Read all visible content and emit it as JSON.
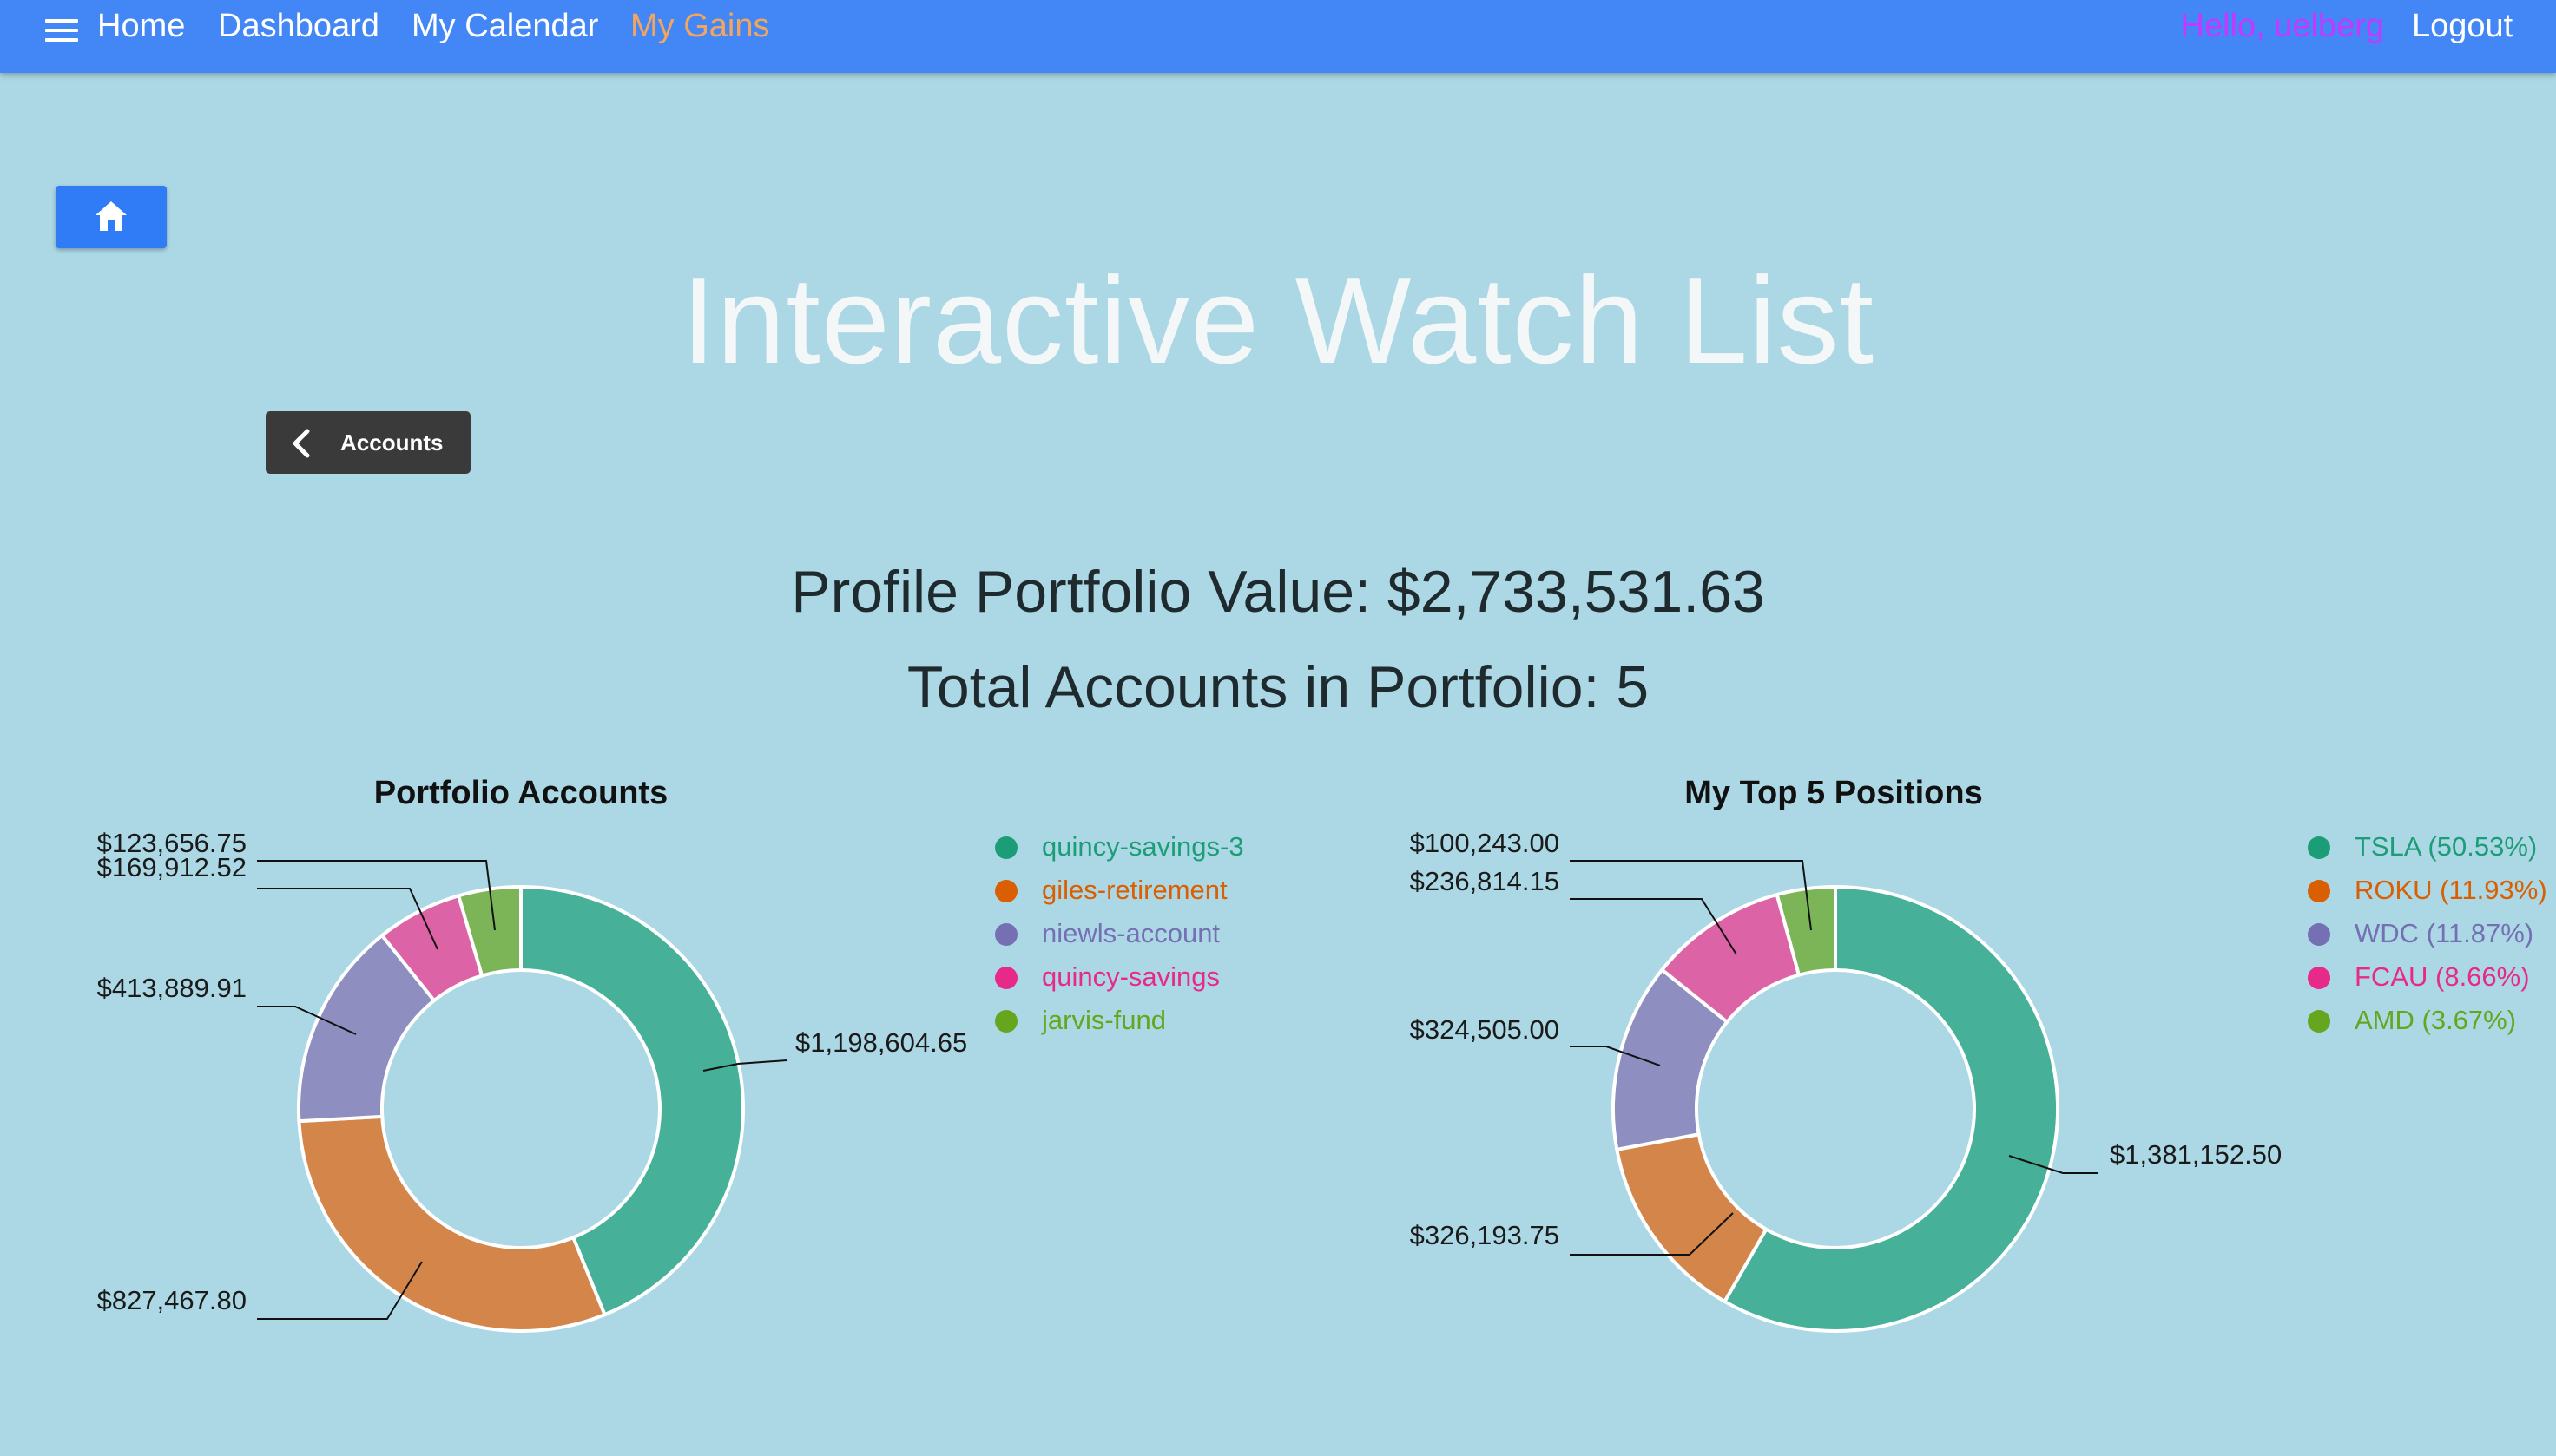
{
  "nav": {
    "menu_icon": "menu-icon",
    "items": [
      "Home",
      "Dashboard",
      "My Calendar",
      "My Gains"
    ],
    "active_color": "#f0a560",
    "greeting": "Hello, uelberg",
    "greeting_color": "#c339ff",
    "logout": "Logout",
    "bar_color": "#4287f5"
  },
  "home_button": {
    "icon": "home-icon",
    "color": "#2f7cf6"
  },
  "page_title": "Interactive Watch List",
  "back_button": {
    "icon": "chevron-left-icon",
    "label": "Accounts"
  },
  "stats": {
    "portfolio_value": "Profile Portfolio Value: $2,733,531.63",
    "total_accounts": "Total Accounts in Portfolio: 5"
  },
  "chart_data": [
    {
      "type": "pie",
      "donut": true,
      "title": "Portfolio Accounts",
      "categories": [
        "quincy-savings-3",
        "giles-retirement",
        "niewls-account",
        "quincy-savings",
        "jarvis-fund"
      ],
      "legend": [
        "quincy-savings-3",
        "giles-retirement",
        "niewls-account",
        "quincy-savings",
        "jarvis-fund"
      ],
      "values": [
        1198604.65,
        827467.8,
        413889.91,
        169912.52,
        123656.75
      ],
      "labels": [
        "$1,198,604.65",
        "$827,467.80",
        "$413,889.91",
        "$169,912.52",
        "$123,656.75"
      ],
      "colors": [
        "#46b098",
        "#d4864a",
        "#8e8ec1",
        "#dc63a6",
        "#7bb558"
      ],
      "legend_colors": [
        "#1b9e77",
        "#d95f02",
        "#7570b3",
        "#e7298a",
        "#66a61e"
      ],
      "legend_placement": "right"
    },
    {
      "type": "pie",
      "donut": true,
      "title": "My Top 5 Positions",
      "categories": [
        "TSLA",
        "ROKU",
        "WDC",
        "FCAU",
        "AMD"
      ],
      "legend": [
        "TSLA (50.53%)",
        "ROKU (11.93%)",
        "WDC (11.87%)",
        "FCAU (8.66%)",
        "AMD (3.67%)"
      ],
      "values": [
        1381152.5,
        326193.75,
        324505.0,
        236814.15,
        100243.0
      ],
      "labels": [
        "$1,381,152.50",
        "$326,193.75",
        "$324,505.00",
        "$236,814.15",
        "$100,243.00"
      ],
      "colors": [
        "#46b098",
        "#d4864a",
        "#8e8ec1",
        "#dc63a6",
        "#7bb558"
      ],
      "legend_colors": [
        "#1b9e77",
        "#d95f02",
        "#7570b3",
        "#e7298a",
        "#66a61e"
      ],
      "legend_placement": "right"
    }
  ]
}
